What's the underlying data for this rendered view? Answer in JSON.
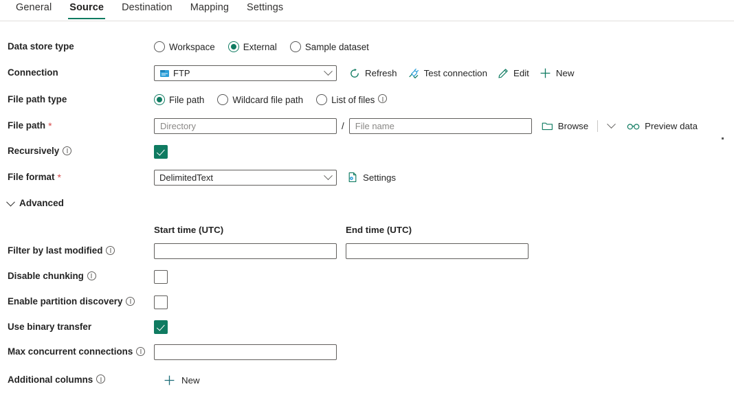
{
  "tabs": [
    {
      "label": "General",
      "active": false
    },
    {
      "label": "Source",
      "active": true
    },
    {
      "label": "Destination",
      "active": false
    },
    {
      "label": "Mapping",
      "active": false
    },
    {
      "label": "Settings",
      "active": false
    }
  ],
  "colors": {
    "accent": "#0f7b61",
    "required_asterisk": "#d64a4a",
    "text": "#242424",
    "border": "#605e5c",
    "link_icon": "#0f7b61"
  },
  "fields": {
    "data_store_type": {
      "label": "Data store type",
      "options": [
        {
          "label": "Workspace",
          "selected": false
        },
        {
          "label": "External",
          "selected": true
        },
        {
          "label": "Sample dataset",
          "selected": false
        }
      ]
    },
    "connection": {
      "label": "Connection",
      "value": "FTP",
      "commands": [
        {
          "label": "Refresh",
          "icon": "refresh-icon"
        },
        {
          "label": "Test connection",
          "icon": "test-connection-icon"
        },
        {
          "label": "Edit",
          "icon": "pencil-icon"
        },
        {
          "label": "New",
          "icon": "plus-icon"
        }
      ]
    },
    "file_path_type": {
      "label": "File path type",
      "options": [
        {
          "label": "File path",
          "selected": true,
          "info": false
        },
        {
          "label": "Wildcard file path",
          "selected": false,
          "info": false
        },
        {
          "label": "List of files",
          "selected": false,
          "info": true
        }
      ]
    },
    "file_path": {
      "label": "File path",
      "required": true,
      "required_marker": "*",
      "directory_value": "",
      "directory_placeholder": "Directory",
      "separator": "/",
      "filename_value": "",
      "filename_placeholder": "File name",
      "browse_label": "Browse",
      "preview_label": "Preview data"
    },
    "recursively": {
      "label": "Recursively",
      "info": true,
      "checked": true
    },
    "file_format": {
      "label": "File format",
      "required": true,
      "required_marker": "*",
      "value": "DelimitedText",
      "settings_label": "Settings"
    },
    "advanced": {
      "label": "Advanced",
      "expanded": true
    },
    "time_filter": {
      "start_header": "Start time (UTC)",
      "end_header": "End time (UTC)",
      "start_value": "",
      "end_value": ""
    },
    "filter_by_last_modified": {
      "label": "Filter by last modified",
      "info": true
    },
    "disable_chunking": {
      "label": "Disable chunking",
      "info": true,
      "checked": false
    },
    "enable_partition_discovery": {
      "label": "Enable partition discovery",
      "info": true,
      "checked": false
    },
    "use_binary_transfer": {
      "label": "Use binary transfer",
      "info": false,
      "checked": true
    },
    "max_concurrent_connections": {
      "label": "Max concurrent connections",
      "info": true,
      "value": ""
    },
    "additional_columns": {
      "label": "Additional columns",
      "info": true,
      "new_label": "New"
    }
  }
}
